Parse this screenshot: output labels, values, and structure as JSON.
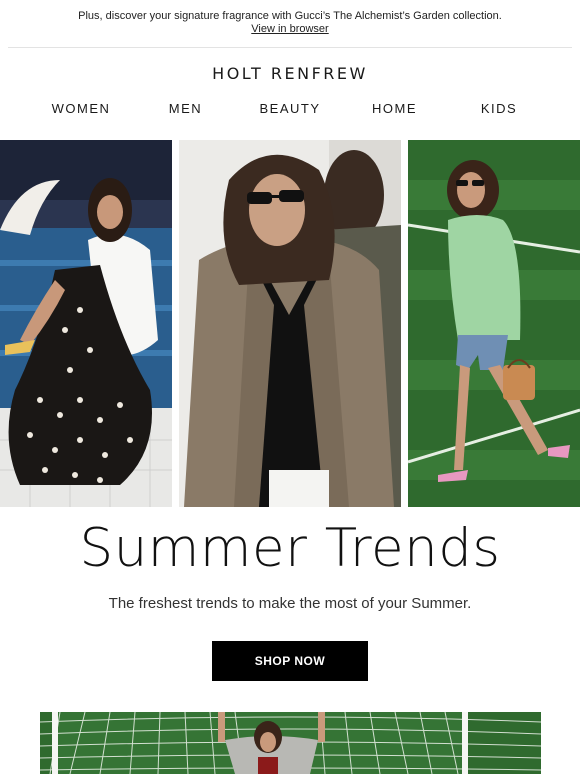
{
  "preheader": {
    "text": "Plus, discover your signature fragrance with Gucci’s The Alchemist’s Garden collection.",
    "view_in_browser": "View in browser"
  },
  "brand": {
    "logo_text": "HOLT RENFREW"
  },
  "nav": {
    "items": [
      {
        "label": "WOMEN"
      },
      {
        "label": "MEN"
      },
      {
        "label": "BEAUTY"
      },
      {
        "label": "HOME"
      },
      {
        "label": "KIDS"
      }
    ]
  },
  "hero": {
    "images": [
      {
        "name": "polka-dot-dress-poolside"
      },
      {
        "name": "taupe-trench-sunglasses"
      },
      {
        "name": "green-blouse-denim-shorts-field"
      }
    ]
  },
  "promo": {
    "headline": "Summer Trends",
    "subhead": "The freshest trends to make the most of your Summer.",
    "cta_label": "SHOP NOW"
  },
  "colors": {
    "accent": "#000000",
    "text": "#1a1a1a",
    "grass": "#2f6a2e",
    "trench": "#8a7a67",
    "blouse": "#9fd5a3"
  }
}
